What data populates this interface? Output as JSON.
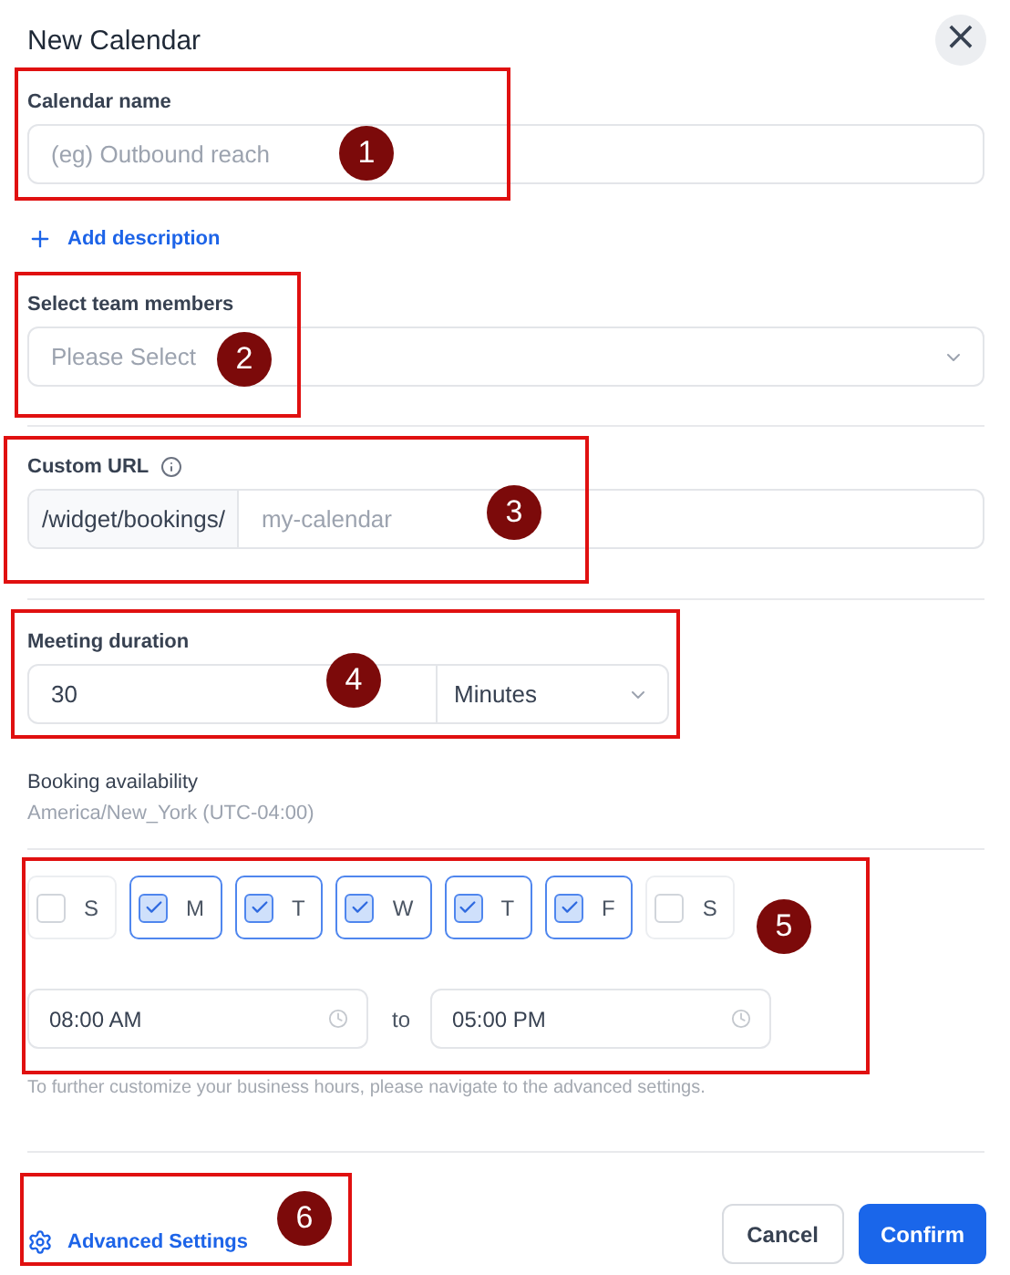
{
  "dialog": {
    "title": "New Calendar",
    "close": "×"
  },
  "calendar_name": {
    "label": "Calendar name",
    "placeholder": "(eg) Outbound reach"
  },
  "add_description": {
    "label": "Add description"
  },
  "team_members": {
    "label": "Select team members",
    "placeholder": "Please Select"
  },
  "custom_url": {
    "label": "Custom URL",
    "prefix": "/widget/bookings/",
    "placeholder": "my-calendar"
  },
  "meeting_duration": {
    "label": "Meeting duration",
    "value": "30",
    "unit": "Minutes"
  },
  "booking_availability": {
    "label": "Booking availability",
    "timezone": "America/New_York (UTC-04:00)"
  },
  "days": [
    {
      "label": "S",
      "checked": false
    },
    {
      "label": "M",
      "checked": true
    },
    {
      "label": "T",
      "checked": true
    },
    {
      "label": "W",
      "checked": true
    },
    {
      "label": "T",
      "checked": true
    },
    {
      "label": "F",
      "checked": true
    },
    {
      "label": "S",
      "checked": false
    }
  ],
  "hours": {
    "from": "08:00 AM",
    "separator": "to",
    "to": "05:00 PM"
  },
  "hint": "To further customize your business hours, please navigate to the advanced settings.",
  "advanced_settings": {
    "label": "Advanced Settings"
  },
  "buttons": [
    {
      "label": "Cancel",
      "kind": "secondary"
    },
    {
      "label": "Confirm",
      "kind": "primary"
    }
  ],
  "annotations": [
    "1",
    "2",
    "3",
    "4",
    "5",
    "6"
  ]
}
